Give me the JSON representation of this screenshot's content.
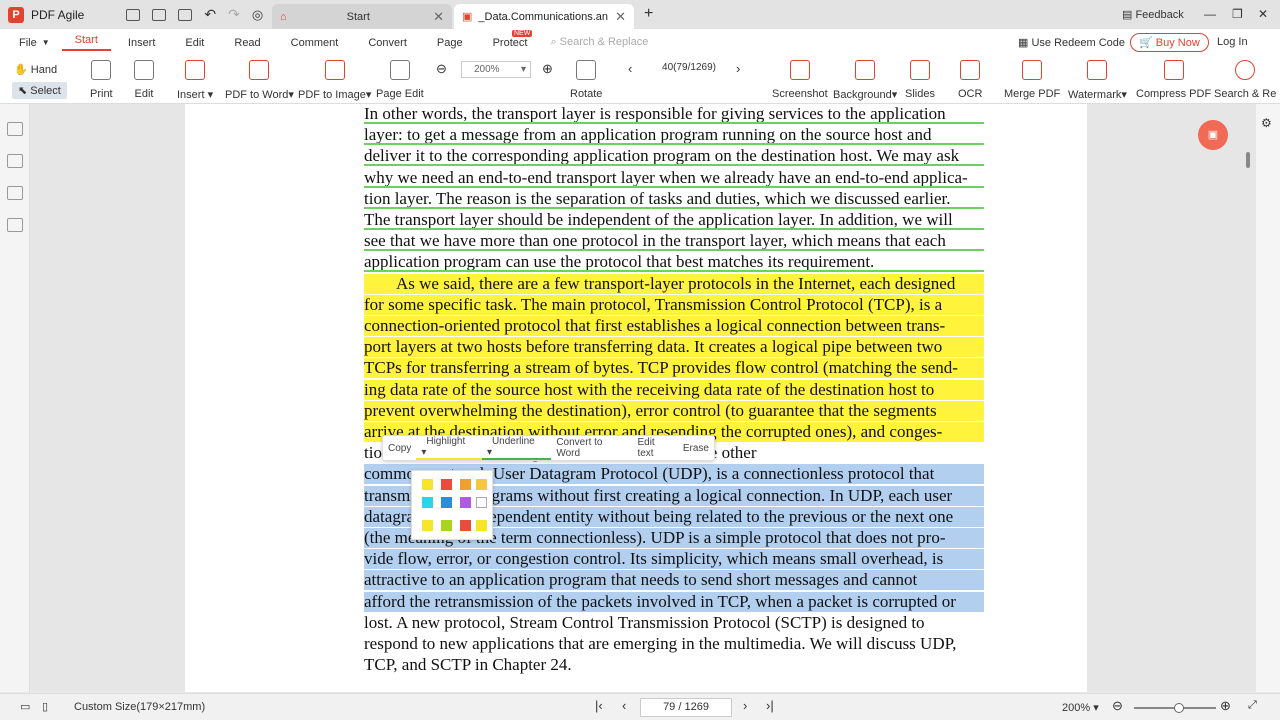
{
  "app": {
    "name": "PDF Agile",
    "logo": "P"
  },
  "tabs": [
    {
      "label": "Start"
    },
    {
      "label": "_Data.Communications.and....*"
    }
  ],
  "titlebar": {
    "feedback": "Feedback"
  },
  "menu": {
    "items": [
      "File",
      "Start",
      "Insert",
      "Edit",
      "Read",
      "Comment",
      "Convert",
      "Page",
      "Protect"
    ],
    "protect_badge": "NEW",
    "search_placeholder": "Search & Replace",
    "redeem": "Use Redeem Code",
    "buy": "Buy Now",
    "login": "Log In"
  },
  "toolbar": {
    "hand": "Hand",
    "select": "Select",
    "print": "Print",
    "edit": "Edit",
    "insert": "Insert",
    "pdf_to_word": "PDF to Word",
    "pdf_to_image": "PDF to Image",
    "page_edit": "Page Edit",
    "zoom": "200%",
    "page_indicator": "40(79/1269)",
    "rotate": "Rotate",
    "screenshot": "Screenshot",
    "background": "Background",
    "slides": "Slides",
    "ocr": "OCR",
    "merge": "Merge PDF",
    "watermark": "Watermark",
    "compress": "Compress PDF",
    "search_re": "Search & Re"
  },
  "text_lines": [
    "In other words, the transport layer is responsible for giving services to the application",
    "layer: to get a message from an application program running on the source host and",
    "deliver it to the corresponding application program on the destination host. We may ask",
    "why we need an end-to-end transport layer when we already have an end-to-end applica-",
    "tion layer. The reason is the separation of tasks and duties, which we discussed earlier.",
    "The transport layer should be independent of the application layer. In addition, we will",
    "see that we have more than one protocol in the transport layer, which means that each",
    "application program can use the protocol that best matches its requirement.",
    "As we said, there are a few transport-layer protocols in the Internet, each designed",
    "for some specific task. The main protocol, Transmission Control Protocol (TCP), is a",
    "connection-oriented protocol that first establishes a logical connection between trans-",
    "port layers at two hosts before transferring data. It creates a logical pipe between two",
    "TCPs for transferring a stream of bytes. TCP provides flow control (matching the send-",
    "ing data rate of the source host with the receiving data rate of the destination host to",
    "prevent overwhelming the destination), error control (to guarantee that the segments",
    "arrive at the destination without error and resending the corrupted ones), and conges-",
    "tion control to avoid congestion in the network. The other",
    "common protocol, User Datagram Protocol (UDP), is a connectionless protocol that",
    "transmits user datagrams without first creating a logical connection. In UDP, each user",
    "datagram is an independent entity without being related to the previous or the next one",
    "(the meaning of the term connectionless). UDP is a simple protocol that does not pro-",
    "vide flow, error, or congestion control. Its simplicity, which means small overhead, is",
    "attractive to an application program that needs to send short messages and cannot",
    "afford the retransmission of the packets involved in TCP, when a packet is corrupted or",
    "lost. A new protocol, Stream Control Transmission Protocol (SCTP) is designed to",
    "respond to new applications that are emerging in the multimedia. We will discuss UDP,",
    "TCP, and SCTP in Chapter 24."
  ],
  "context_menu": {
    "copy": "Copy",
    "highlight": "Highlight",
    "underline": "Underline",
    "convert": "Convert to Word",
    "edit_text": "Edit text",
    "erase": "Erase"
  },
  "palette_colors": [
    "#f5e62b",
    "#e94b3c",
    "#f0a030",
    "#f5c840",
    "#2bd4e8",
    "#2a8fd8",
    "#b05ae0",
    "#ffffff",
    "#f5e62b",
    "#a8d420",
    "#e94b3c",
    "#f5e62b"
  ],
  "status": {
    "size": "Custom Size(179×217mm)",
    "page": "79 / 1269",
    "zoom": "200%"
  }
}
